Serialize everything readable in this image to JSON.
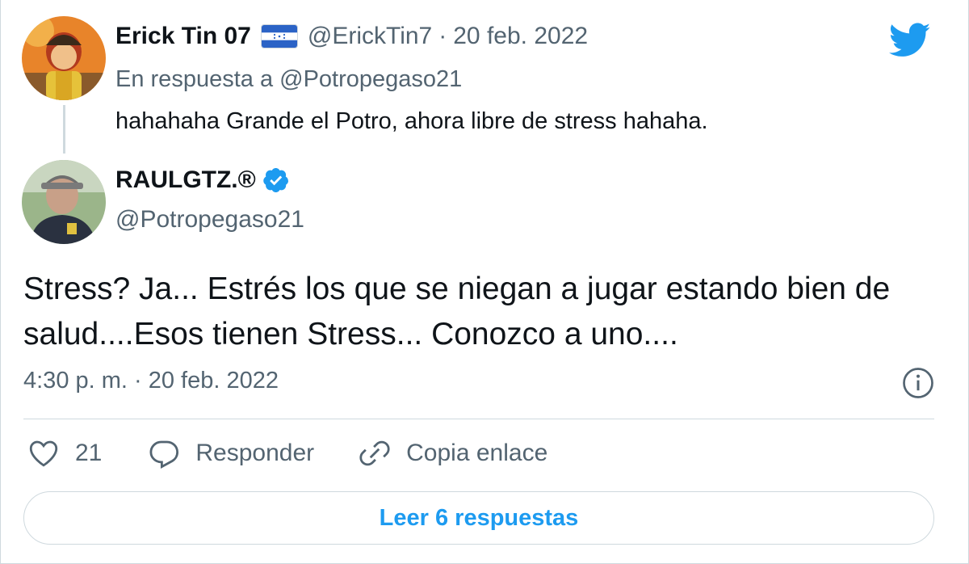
{
  "colors": {
    "twitter_blue": "#1d9bf0",
    "secondary_text": "#536471",
    "primary_text": "#0f1419",
    "border": "#cfd9de"
  },
  "parent_tweet": {
    "display_name": "Erick Tin 07",
    "flag_icon": "honduras-flag-icon",
    "handle": "@ErickTin7",
    "separator": "·",
    "date": "20 feb. 2022",
    "reply_to": "En respuesta a @Potropegaso21",
    "text": "hahahaha Grande el Potro, ahora libre de stress hahaha."
  },
  "main_tweet": {
    "display_name": "RAULGTZ.®",
    "verified_icon": "verified-badge-icon",
    "handle": "@Potropegaso21",
    "text": "Stress? Ja... Estrés los que se niegan a jugar estando bien de salud....Esos tienen Stress... Conozco a uno....",
    "timestamp": "4:30 p. m. · 20 feb. 2022"
  },
  "actions": {
    "like_count": "21",
    "reply_label": "Responder",
    "copy_link_label": "Copia enlace"
  },
  "read_replies_label": "Leer 6 respuestas"
}
